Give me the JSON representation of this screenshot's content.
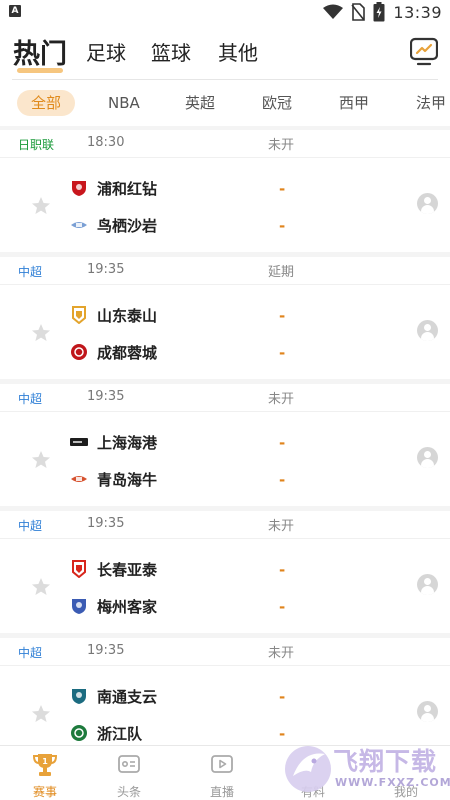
{
  "status_bar": {
    "time": "13:39"
  },
  "top_tabs": [
    "热门",
    "足球",
    "篮球",
    "其他"
  ],
  "filters": [
    "全部",
    "NBA",
    "英超",
    "欧冠",
    "西甲",
    "法甲"
  ],
  "matches": [
    {
      "league": "日职联",
      "league_color": "#1a9a3a",
      "time": "18:30",
      "status": "未开",
      "home": "浦和红钻",
      "away": "鸟栖沙岩",
      "home_score": "-",
      "away_score": "-",
      "home_badge_color": "#c8161d",
      "away_badge_color": "#7a9fd4"
    },
    {
      "league": "中超",
      "league_color": "#2f7fd6",
      "time": "19:35",
      "status": "延期",
      "home": "山东泰山",
      "away": "成都蓉城",
      "home_score": "-",
      "away_score": "-",
      "home_badge_color": "#e3a42c",
      "away_badge_color": "#c0161b"
    },
    {
      "league": "中超",
      "league_color": "#2f7fd6",
      "time": "19:35",
      "status": "未开",
      "home": "上海海港",
      "away": "青岛海牛",
      "home_score": "-",
      "away_score": "-",
      "home_badge_color": "#1d1d1d",
      "away_badge_color": "#d6512e"
    },
    {
      "league": "中超",
      "league_color": "#2f7fd6",
      "time": "19:35",
      "status": "未开",
      "home": "长春亚泰",
      "away": "梅州客家",
      "home_score": "-",
      "away_score": "-",
      "home_badge_color": "#d8261c",
      "away_badge_color": "#3b5bb3"
    },
    {
      "league": "中超",
      "league_color": "#2f7fd6",
      "time": "19:35",
      "status": "未开",
      "home": "南通支云",
      "away": "浙江队",
      "home_score": "-",
      "away_score": "-",
      "home_badge_color": "#1b6b80",
      "away_badge_color": "#1d7a3c"
    }
  ],
  "bottom_nav": [
    "赛事",
    "头条",
    "直播",
    "有料",
    "我的"
  ],
  "watermark": {
    "title": "飞翔下载",
    "url": "WWW.FXXZ.COM"
  },
  "colors": {
    "accent": "#e08a1c",
    "accent_light": "#fbe6cc"
  }
}
